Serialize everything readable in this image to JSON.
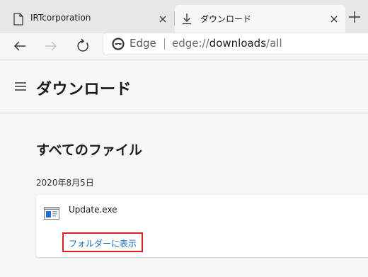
{
  "tabs": [
    {
      "title": "IRTcorporation",
      "icon": "page-icon",
      "active": false
    },
    {
      "title": "ダウンロード",
      "icon": "download-icon",
      "active": true
    }
  ],
  "toolbar": {
    "identity_label": "Edge",
    "url_scheme": "edge://",
    "url_host": "downloads",
    "url_path": "/all"
  },
  "page": {
    "title": "ダウンロード",
    "section_title": "すべてのファイル",
    "date_group": "2020年8月5日",
    "downloads": [
      {
        "file_name": "Update.exe",
        "action_label": "フォルダーに表示"
      }
    ]
  },
  "colors": {
    "accent_link": "#0f6cbd",
    "highlight_box": "#e02020",
    "tabstrip_bg": "#e7e7e7",
    "page_bg": "#f7f7f7"
  }
}
